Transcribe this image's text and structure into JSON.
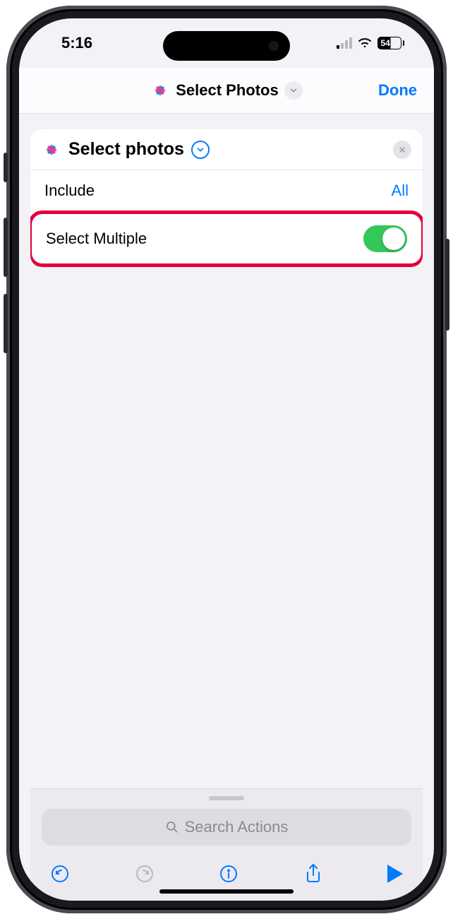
{
  "status": {
    "time": "5:16",
    "battery_pct": "54"
  },
  "header": {
    "title": "Select Photos",
    "done_label": "Done"
  },
  "action_card": {
    "title": "Select photos",
    "include_label": "Include",
    "include_value": "All",
    "select_multiple_label": "Select Multiple",
    "select_multiple_on": true
  },
  "search": {
    "placeholder": "Search Actions"
  }
}
